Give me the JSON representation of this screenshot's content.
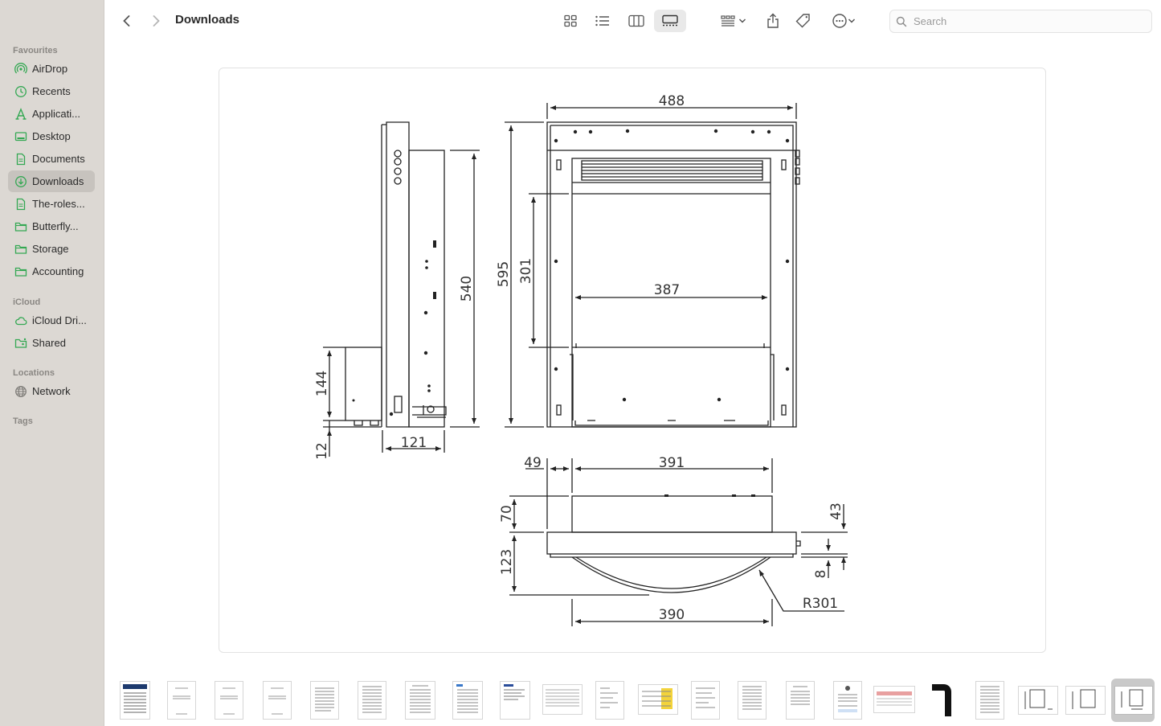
{
  "sidebar": {
    "sections": {
      "favourites": "Favourites",
      "icloud": "iCloud",
      "locations": "Locations",
      "tags": "Tags"
    },
    "items": [
      {
        "label": "AirDrop",
        "icon": "airdrop-icon"
      },
      {
        "label": "Recents",
        "icon": "clock-icon"
      },
      {
        "label": "Applicati...",
        "icon": "applications-icon"
      },
      {
        "label": "Desktop",
        "icon": "desktop-icon"
      },
      {
        "label": "Documents",
        "icon": "document-icon"
      },
      {
        "label": "Downloads",
        "icon": "download-icon",
        "selected": true
      },
      {
        "label": "The-roles...",
        "icon": "document-icon"
      },
      {
        "label": "Butterfly...",
        "icon": "folder-icon"
      },
      {
        "label": "Storage",
        "icon": "folder-icon"
      },
      {
        "label": "Accounting",
        "icon": "folder-icon"
      },
      {
        "label": "iCloud Dri...",
        "icon": "cloud-icon"
      },
      {
        "label": "Shared",
        "icon": "shared-folder-icon"
      },
      {
        "label": "Network",
        "icon": "globe-icon"
      }
    ],
    "accent_color": "#34a853"
  },
  "toolbar": {
    "title": "Downloads",
    "search_placeholder": "Search",
    "view_modes": [
      "icon-view",
      "list-view",
      "column-view",
      "gallery-view"
    ],
    "active_view": "gallery-view"
  },
  "drawing": {
    "dims": {
      "side_height": "540",
      "side_box": "144",
      "side_foot": "12",
      "side_depth": "121",
      "front_width": "488",
      "front_height": "595",
      "front_opening_h": "301",
      "front_opening_w": "387",
      "top_offset": "49",
      "top_width": "391",
      "top_depth": "70",
      "top_lip": "43",
      "top_front": "123",
      "top_gap": "8",
      "top_radius": "R301",
      "top_bottom_width": "390"
    }
  },
  "thumbnails_count": 22
}
